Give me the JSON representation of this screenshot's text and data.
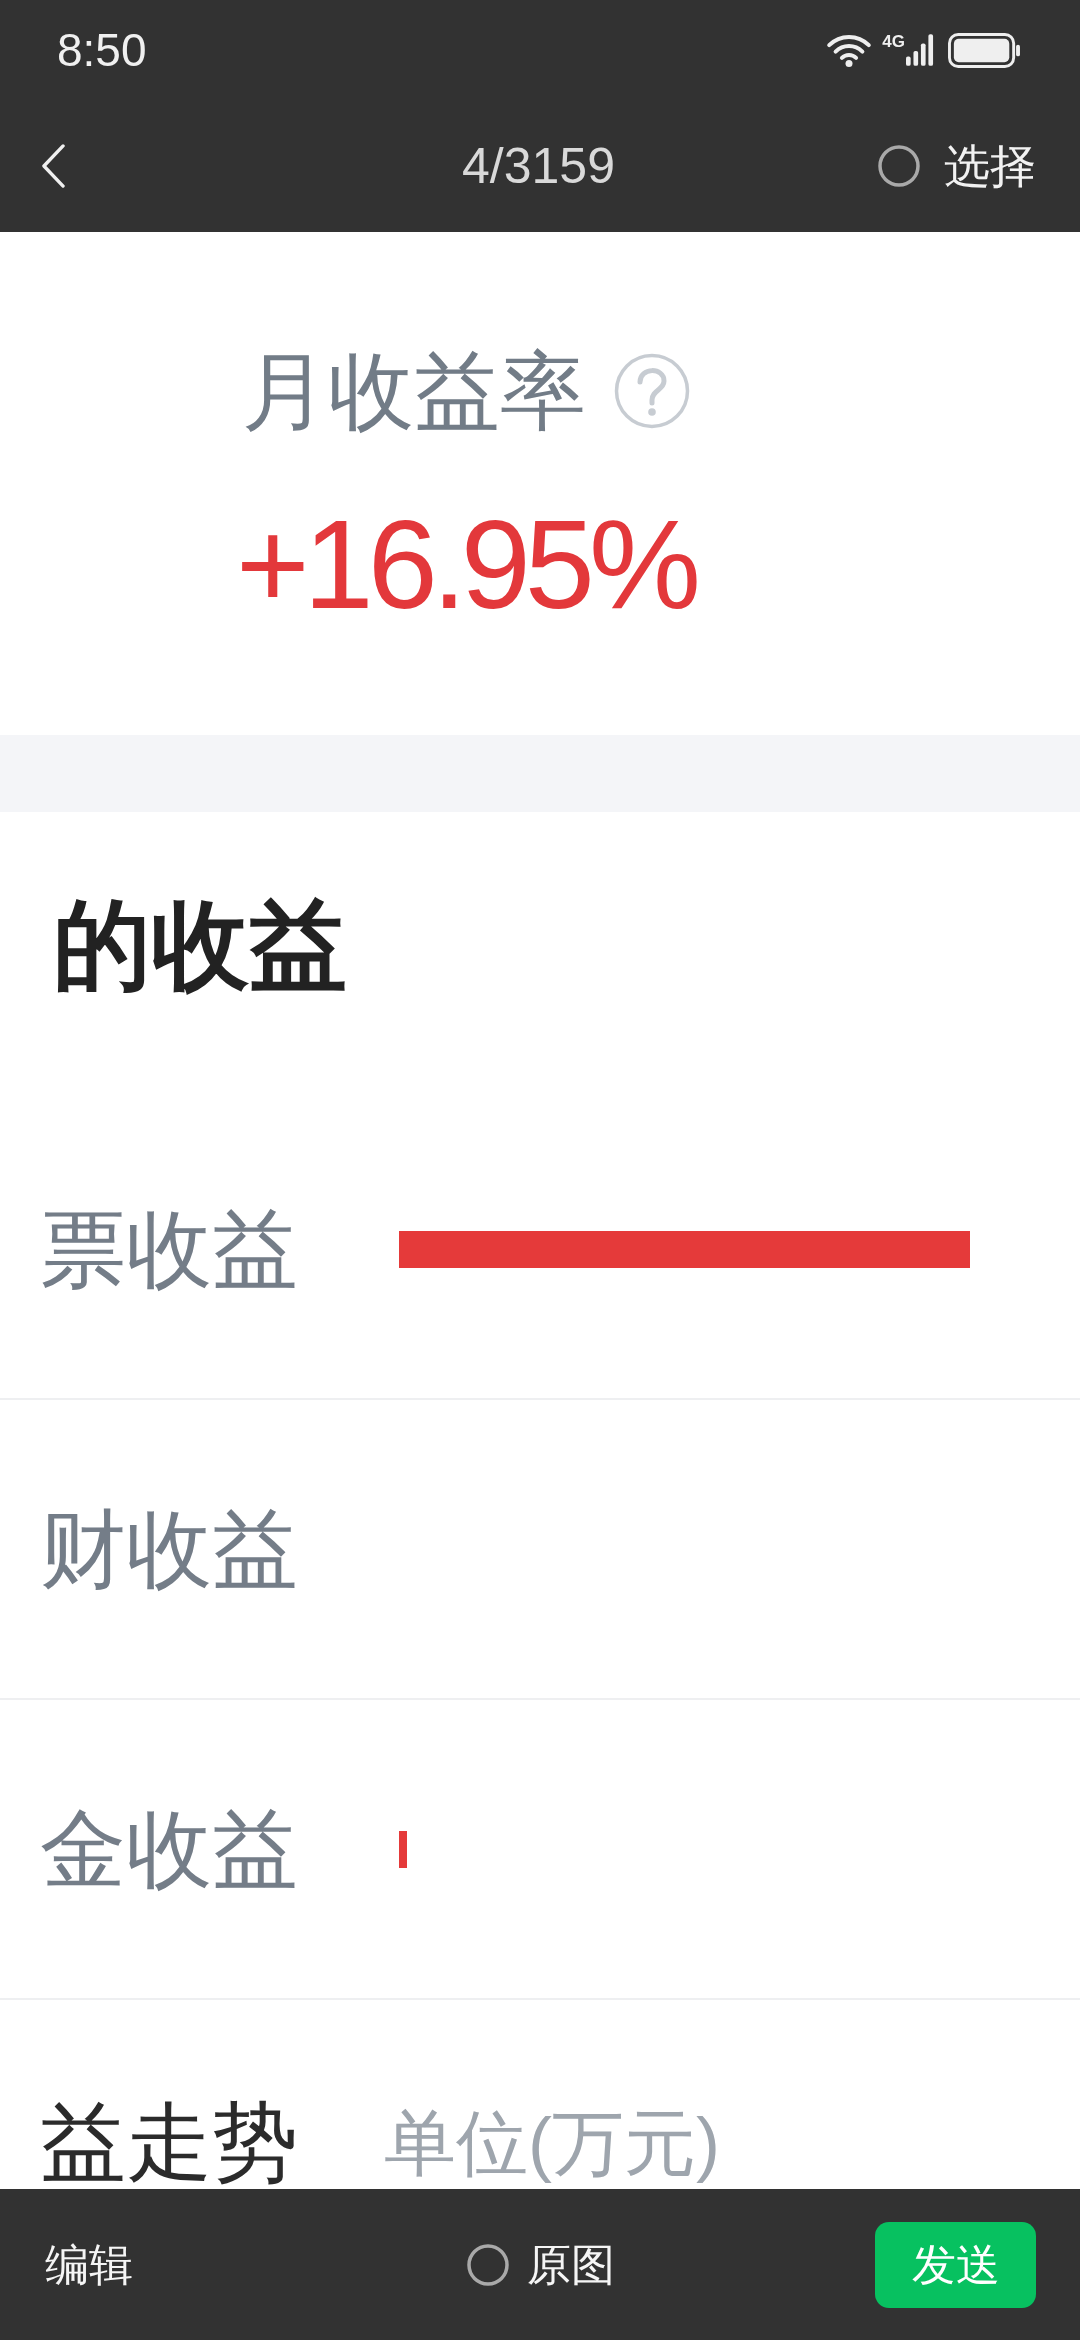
{
  "status_bar": {
    "time": "8:50",
    "network": "4G"
  },
  "top_bar": {
    "counter": "4/3159",
    "select": {
      "label": "选择",
      "selected": false
    }
  },
  "image": {
    "rate": {
      "label": "月收益率",
      "value": "+16.95%"
    },
    "section": {
      "title": "的收益",
      "rows": [
        {
          "label": "票收益"
        },
        {
          "label": "财收益"
        },
        {
          "label": "金收益"
        }
      ]
    },
    "trend": {
      "title": "益走势",
      "unit": "单位(万元)"
    }
  },
  "bottom_bar": {
    "edit": "编辑",
    "original": {
      "label": "原图",
      "selected": false
    },
    "send": "发送"
  }
}
